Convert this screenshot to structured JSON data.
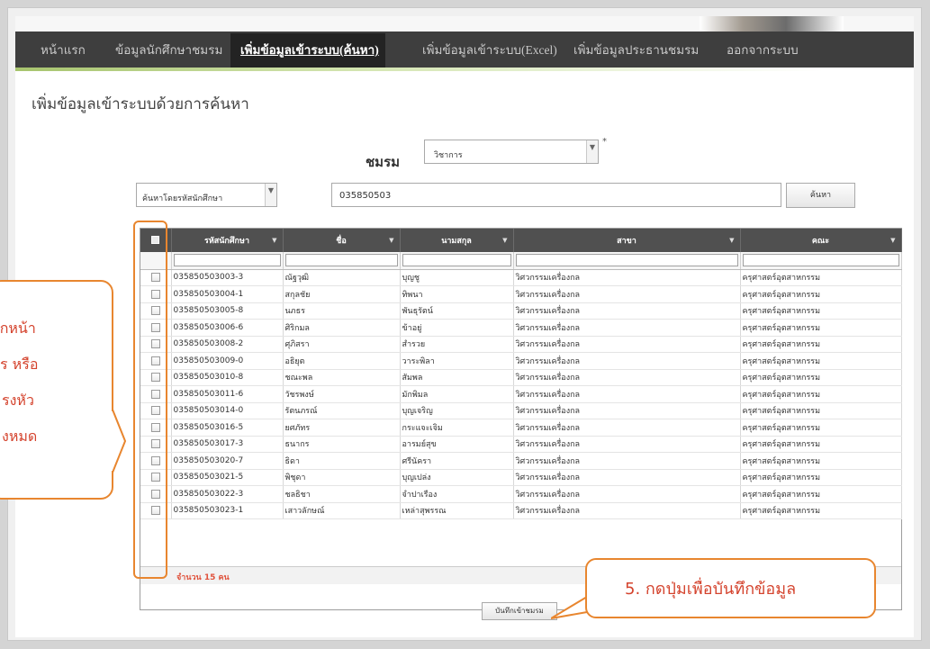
{
  "nav": {
    "items": [
      {
        "label": "หน้าแรก",
        "active": false
      },
      {
        "label": "ข้อมูลนักศึกษาชมรม",
        "active": false
      },
      {
        "label": "เพิ่มข้อมูลเข้าระบบ(ค้นหา)",
        "active": true
      },
      {
        "label": "เพิ่มข้อมูลเข้าระบบ(Excel)",
        "active": false
      },
      {
        "label": "เพิ่มข้อมูลประธานชมรม",
        "active": false
      },
      {
        "label": "ออกจากระบบ",
        "active": false
      }
    ]
  },
  "page": {
    "title": "เพิ่มข้อมูลเข้าระบบด้วยการค้นหา"
  },
  "club": {
    "label": "ชมรม",
    "selected": "วิชาการ",
    "required_mark": "*"
  },
  "search": {
    "type_selected": "ค้นหาโดยรหัสนักศึกษา",
    "query": "035850503",
    "button_label": "ค้นหา"
  },
  "grid": {
    "columns": [
      {
        "key": "student_id",
        "label": "รหัสนักศึกษา"
      },
      {
        "key": "first_name",
        "label": "ชื่อ"
      },
      {
        "key": "last_name",
        "label": "นามสกุล"
      },
      {
        "key": "major",
        "label": "สาขา"
      },
      {
        "key": "faculty",
        "label": "คณะ"
      }
    ],
    "rows": [
      {
        "student_id": "035850503003-3",
        "first_name": "ณัฐวุฒิ",
        "last_name": "บุญชู",
        "major": "วิศวกรรมเครื่องกล",
        "faculty": "ครุศาสตร์อุตสาหกรรม"
      },
      {
        "student_id": "035850503004-1",
        "first_name": "สกุลชัย",
        "last_name": "ทิพนา",
        "major": "วิศวกรรมเครื่องกล",
        "faculty": "ครุศาสตร์อุตสาหกรรม"
      },
      {
        "student_id": "035850503005-8",
        "first_name": "นภธร",
        "last_name": "พันธุรัตน์",
        "major": "วิศวกรรมเครื่องกล",
        "faculty": "ครุศาสตร์อุตสาหกรรม"
      },
      {
        "student_id": "035850503006-6",
        "first_name": "ศิริกมล",
        "last_name": "ข้าอยู่",
        "major": "วิศวกรรมเครื่องกล",
        "faculty": "ครุศาสตร์อุตสาหกรรม"
      },
      {
        "student_id": "035850503008-2",
        "first_name": "ศุภิสรา",
        "last_name": "สำรวย",
        "major": "วิศวกรรมเครื่องกล",
        "faculty": "ครุศาสตร์อุตสาหกรรม"
      },
      {
        "student_id": "035850503009-0",
        "first_name": "อธิยุต",
        "last_name": "วาระพิลา",
        "major": "วิศวกรรมเครื่องกล",
        "faculty": "ครุศาสตร์อุตสาหกรรม"
      },
      {
        "student_id": "035850503010-8",
        "first_name": "ชณะพล",
        "last_name": "สัมพล",
        "major": "วิศวกรรมเครื่องกล",
        "faculty": "ครุศาสตร์อุตสาหกรรม"
      },
      {
        "student_id": "035850503011-6",
        "first_name": "วัชรพงษ์",
        "last_name": "มักพิมล",
        "major": "วิศวกรรมเครื่องกล",
        "faculty": "ครุศาสตร์อุตสาหกรรม"
      },
      {
        "student_id": "035850503014-0",
        "first_name": "รัตนภรณ์",
        "last_name": "บุญเจริญ",
        "major": "วิศวกรรมเครื่องกล",
        "faculty": "ครุศาสตร์อุตสาหกรรม"
      },
      {
        "student_id": "035850503016-5",
        "first_name": "ยศภัทร",
        "last_name": "กระแจะเจิม",
        "major": "วิศวกรรมเครื่องกล",
        "faculty": "ครุศาสตร์อุตสาหกรรม"
      },
      {
        "student_id": "035850503017-3",
        "first_name": "ธนากร",
        "last_name": "อารมย์สุข",
        "major": "วิศวกรรมเครื่องกล",
        "faculty": "ครุศาสตร์อุตสาหกรรม"
      },
      {
        "student_id": "035850503020-7",
        "first_name": "ธิดา",
        "last_name": "ศรีนัครา",
        "major": "วิศวกรรมเครื่องกล",
        "faculty": "ครุศาสตร์อุตสาหกรรม"
      },
      {
        "student_id": "035850503021-5",
        "first_name": "พิชุดา",
        "last_name": "บุญเปล่ง",
        "major": "วิศวกรรมเครื่องกล",
        "faculty": "ครุศาสตร์อุตสาหกรรม"
      },
      {
        "student_id": "035850503022-3",
        "first_name": "ชลธิชา",
        "last_name": "จำปาเรือง",
        "major": "วิศวกรรมเครื่องกล",
        "faculty": "ครุศาสตร์อุตสาหกรรม"
      },
      {
        "student_id": "035850503023-1",
        "first_name": "เสาวลักษณ์",
        "last_name": "เหล่าสุพรรณ",
        "major": "วิศวกรรมเครื่องกล",
        "faculty": "ครุศาสตร์อุตสาหกรรม"
      }
    ],
    "footer_count": "จำนวน 15 คน"
  },
  "save_button_label": "บันทึกเข้าชมรม",
  "annotations": {
    "left_lines": [
      "ถูกหน้า",
      "ร หรือ",
      "รงหัว",
      "งหมด"
    ],
    "right_text": "5. กดปุ่มเพื่อบันทึกข้อมูล"
  },
  "colors": {
    "nav_bg": "#3e3e3e",
    "accent_green": "#a7c46e",
    "callout_border": "#e8862f",
    "callout_text": "#d4432d",
    "header_bg": "#505050"
  }
}
